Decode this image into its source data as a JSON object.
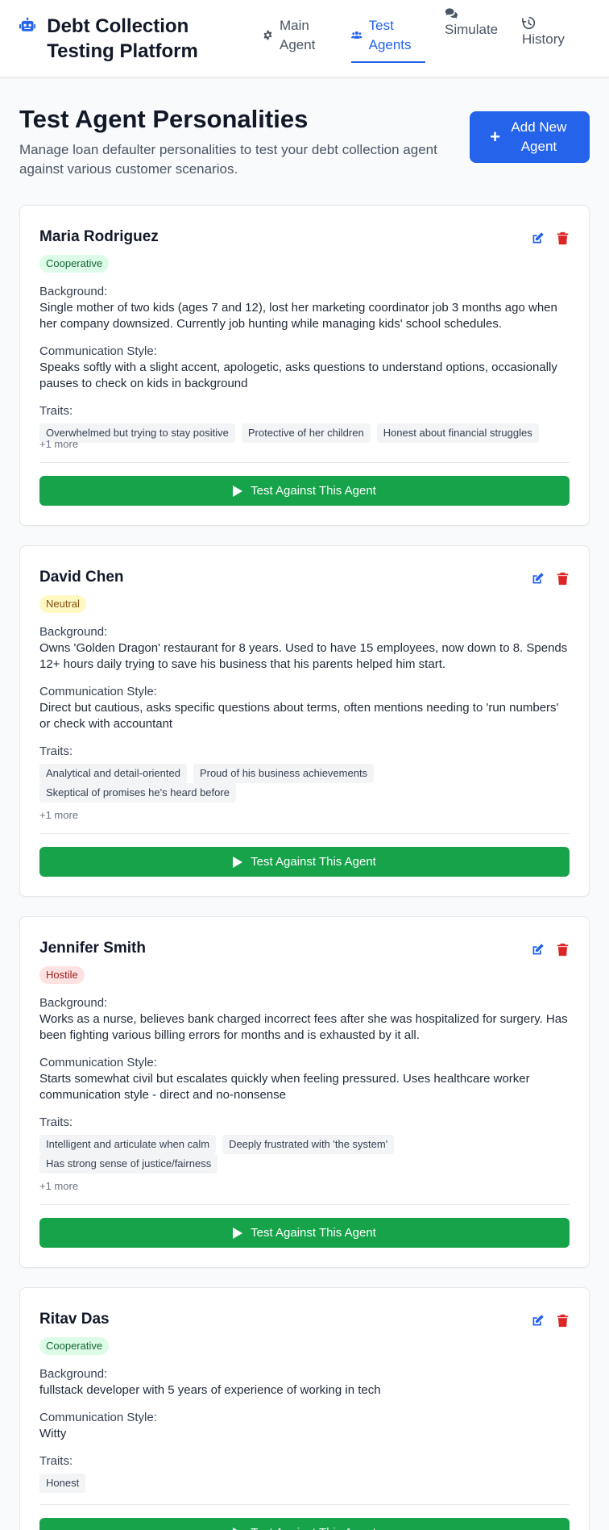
{
  "header": {
    "title": "Debt Collection Testing Platform",
    "logo_icon": "robot-icon",
    "nav": [
      {
        "label": "Main Agent",
        "icon": "gear-icon"
      },
      {
        "label": "Test Agents",
        "icon": "users-icon",
        "active": true
      },
      {
        "label": "Simulate",
        "icon": "chat-icon"
      },
      {
        "label": "History",
        "icon": "history-icon"
      }
    ]
  },
  "page": {
    "title": "Test Agent Personalities",
    "subtitle": "Manage loan defaulter personalities to test your debt collection agent against various customer scenarios.",
    "add_button": "Add New Agent"
  },
  "labels": {
    "background": "Background:",
    "communication": "Communication Style:",
    "traits": "Traits:",
    "test_button": "Test Against This Agent"
  },
  "agents": [
    {
      "name": "Maria Rodriguez",
      "disposition": "Cooperative",
      "background": "Single mother of two kids (ages 7 and 12), lost her marketing coordinator job 3 months ago when her company downsized. Currently job hunting while managing kids' school schedules.",
      "communication": "Speaks softly with a slight accent, apologetic, asks questions to understand options, occasionally pauses to check on kids in background",
      "traits": [
        "Overwhelmed but trying to stay positive",
        "Protective of her children",
        "Honest about financial struggles"
      ],
      "more": "+1 more"
    },
    {
      "name": "David Chen",
      "disposition": "Neutral",
      "background": "Owns 'Golden Dragon' restaurant for 8 years. Used to have 15 employees, now down to 8. Spends 12+ hours daily trying to save his business that his parents helped him start.",
      "communication": "Direct but cautious, asks specific questions about terms, often mentions needing to 'run numbers' or check with accountant",
      "traits": [
        "Analytical and detail-oriented",
        "Proud of his business achievements",
        "Skeptical of promises he's heard before"
      ],
      "more": "+1 more"
    },
    {
      "name": "Jennifer Smith",
      "disposition": "Hostile",
      "background": "Works as a nurse, believes bank charged incorrect fees after she was hospitalized for surgery. Has been fighting various billing errors for months and is exhausted by it all.",
      "communication": "Starts somewhat civil but escalates quickly when feeling pressured. Uses healthcare worker communication style - direct and no-nonsense",
      "traits": [
        "Intelligent and articulate when calm",
        "Deeply frustrated with 'the system'",
        "Has strong sense of justice/fairness"
      ],
      "more": "+1 more"
    },
    {
      "name": "Ritav Das",
      "disposition": "Cooperative",
      "background": "fullstack developer with 5 years of experience of working in tech",
      "communication": "Witty",
      "traits": [
        "Honest"
      ]
    }
  ],
  "colors": {
    "primary": "#2563eb",
    "success": "#16a34a",
    "danger": "#dc2626"
  }
}
